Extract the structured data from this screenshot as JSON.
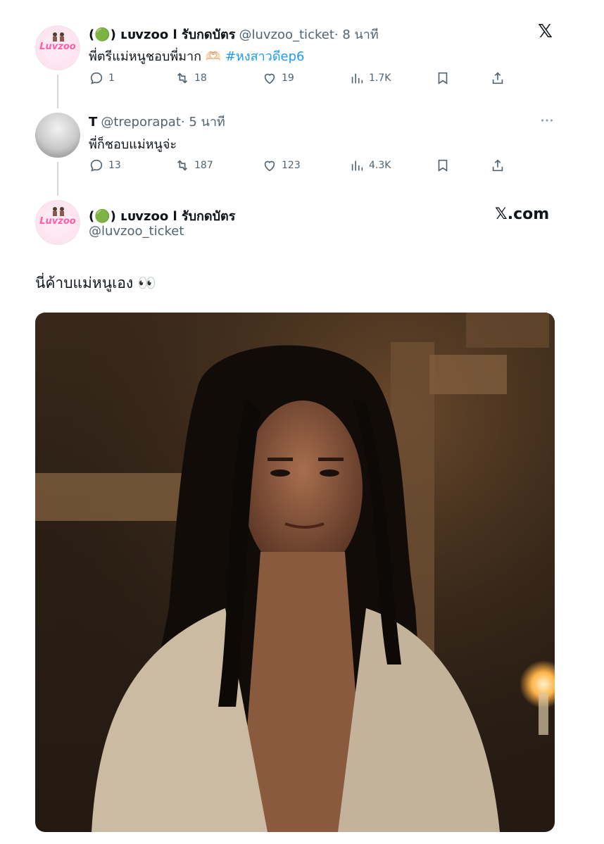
{
  "tweet1": {
    "display_name": "(🟢) ʟᴜᴠzᴏᴏ l รับกดบัตร",
    "handle": "@luvzoo_ticket",
    "time": "· 8 นาที",
    "text_prefix": "พี่ตรีแม่หนูชอบพี่มาก 🫶🏻",
    "hashtag": "#หงสาวดีep6",
    "replies": "1",
    "reposts": "18",
    "likes": "19",
    "views": "1.7K",
    "avatar_logo": "Luvzoo"
  },
  "tweet2": {
    "display_name": "T",
    "handle": "@treporapat",
    "time": "· 5 นาที",
    "text": "พี่ก็ชอบแม่หนูจ่ะ",
    "replies": "13",
    "reposts": "187",
    "likes": "123",
    "views": "4.3K"
  },
  "tweet3": {
    "display_name": "(🟢) ʟᴜᴠzᴏᴏ l รับกดบัตร",
    "handle": "@luvzoo_ticket",
    "text": "นี่ค้าบแม่หนูเอง 👀",
    "avatar_logo": "Luvzoo"
  },
  "brand": {
    "x_icon": "𝕏",
    "x_domain": "𝕏.com"
  },
  "icons": [
    "reply-icon",
    "repost-icon",
    "like-icon",
    "views-icon",
    "bookmark-icon",
    "share-icon",
    "more-icon",
    "x-logo-icon"
  ],
  "colors": {
    "hashtag": "#1d9bf0",
    "muted": "#536471",
    "text": "#0f1419",
    "thread_line": "#cfd9de"
  }
}
